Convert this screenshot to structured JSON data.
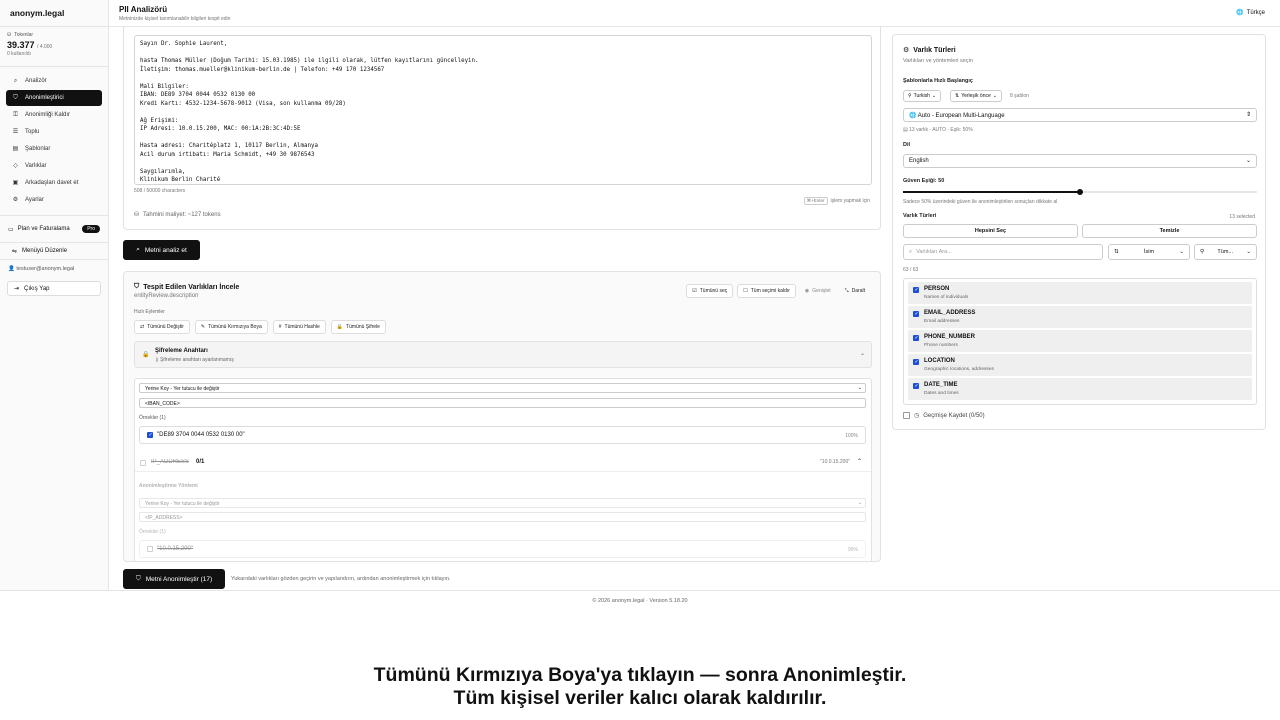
{
  "brand": "anonym.legal",
  "tokens": {
    "label": "Tokenlar",
    "value": "39.377",
    "max": "/ 4.000",
    "used": "0 kullanıldı"
  },
  "nav": [
    {
      "label": "Analizör",
      "icon": "search-icon"
    },
    {
      "label": "Anonimleştirici",
      "icon": "shield-icon",
      "active": true
    },
    {
      "label": "Anonimliği Kaldır",
      "icon": "unlock-icon"
    },
    {
      "label": "Toplu",
      "icon": "layers-icon"
    },
    {
      "label": "Şablonlar",
      "icon": "file-icon"
    },
    {
      "label": "Varlıklar",
      "icon": "tag-icon"
    },
    {
      "label": "Arkadaşları davet et",
      "icon": "gift-icon"
    },
    {
      "label": "Ayarlar",
      "icon": "gear-icon"
    }
  ],
  "plan": {
    "label": "Plan ve Faturalama",
    "badge": "Pro"
  },
  "menu_edit": "Menüyü Düzenle",
  "user": {
    "email": "testuser@anonym.legal",
    "logout": "Çıkış Yap"
  },
  "header": {
    "title": "PII Analizörü",
    "subtitle": "Metninizde kişisel tanımlanabilir bilgileri tespit edin",
    "language": "Türkçe"
  },
  "input": {
    "text": "Sayın Dr. Sophie Laurent,\n\nhasta Thomas Müller (Doğum Tarihi: 15.03.1985) ile ilgili olarak, lütfen kayıtlarını güncelleyin.\nİletişim: thomas.mueller@klinikum-berlin.de | Telefon: +49 170 1234567\n\nMali Bilgiler:\nIBAN: DE89 3704 0044 0532 0130 00\nKredi Kartı: 4532-1234-5678-9012 (Visa, son kullanma 09/28)\n\nAğ Erişimi:\nIP Adresi: 10.0.15.200, MAC: 00:1A:2B:3C:4D:5E\n\nHasta adresi: Charitéplatz 1, 10117 Berlin, Almanya\nAcil durum irtibatı: Maria Schmidt, +49 30 9876543\n\nSaygılarımla,\nKlinikum Berlin Charité",
    "char_count": "508 / 50000 characters",
    "shortcut_key": "⌘+Enter",
    "shortcut_hint": "işlem yapmak için",
    "cost": "Tahmini maliyet: ~127 tokens"
  },
  "analyze_button": "Metni analiz et",
  "review": {
    "title": "Tespit Edilen Varlıkları İncele",
    "description": "entityReview.description",
    "select_all": "Tümünü seç",
    "deselect_all": "Tüm seçimi kaldır",
    "expand": "Genişlet",
    "collapse": "Daralt",
    "quick_label": "Hızlı Eylemler",
    "quick": [
      {
        "label": "Tümünü Değiştir",
        "icon": "replace-icon"
      },
      {
        "label": "Tümünü Kırmızıya Boya",
        "icon": "redact-icon"
      },
      {
        "label": "Tümünü Hashle",
        "icon": "hash-icon"
      },
      {
        "label": "Tümünü Şifrele",
        "icon": "lock-icon"
      }
    ],
    "encryption": {
      "title": "Şifreleme Anahtarı",
      "subtitle": "Şifreleme anahtarı ayarlanmamış"
    },
    "iban": {
      "method": "Yerine Koy - Yer tutucu ile değiştir",
      "placeholder": "<IBAN_CODE>",
      "examples_label": "Örnekler (1)",
      "example": "\"DE89 3704 0044 0532 0130 00\"",
      "score": "100%"
    },
    "ip": {
      "name": "IP_ADDRESS",
      "count": "0/1",
      "preview": "\"10.0.15.200\"",
      "method_label": "Anonimleştirme Yöntemi",
      "method": "Yerine Koy - Yer tutucu ile değiştir",
      "placeholder": "<IP_ADDRESS>",
      "examples_label": "Örnekler (1)",
      "example": "\"10.0.15.200\"",
      "score": "95%"
    }
  },
  "anonymize_button": "Metni Anonimleştir (17)",
  "anonymize_hint": "Yukarıdaki varlıkları gözden geçirin ve yapılandırın, ardından anonimleştirmek için tıklayın.",
  "right": {
    "title": "Varlık Türleri",
    "subtitle": "Varlıkları ve yöntemleri seçin",
    "quick_start": "Şablonlarla Hızlı Başlangıç",
    "chip_lang": "Turkish",
    "chip_sort": "Yerleşik önce",
    "template_count": "8 şablon",
    "preset": "🌐 Auto - European Multi-Language",
    "preset_meta": "13 varlık · AUTO · Eşik: 50%",
    "lang_label": "Dil",
    "lang_value": "English",
    "threshold_label": "Güven Eşiği: 50",
    "threshold": 0.5,
    "threshold_hint": "Sadece 50% üzerindeki güven ile anonimleştirilen sonuçları dikkate al",
    "types_label": "Varlık Türleri",
    "selected": "13 selected",
    "select_all": "Hepsini Seç",
    "clear": "Temizle",
    "search_placeholder": "Varlıkları Ara...",
    "sort_name": "İsim",
    "filter_all": "Tüm...",
    "count": "63 / 63",
    "entities": [
      {
        "name": "PERSON",
        "desc": "Names of individuals"
      },
      {
        "name": "EMAIL_ADDRESS",
        "desc": "Email addresses"
      },
      {
        "name": "PHONE_NUMBER",
        "desc": "Phone numbers"
      },
      {
        "name": "LOCATION",
        "desc": "Geographic locations, addresses"
      },
      {
        "name": "DATE_TIME",
        "desc": "Dates and times"
      }
    ],
    "history": "Geçmişe Kaydet (0/50)"
  },
  "footer": "© 2026 anonym.legal · Version 5.18.20",
  "caption_line1": "Tümünü Kırmızıya Boya'ya tıklayın — sonra Anonimleştir.",
  "caption_line2": "Tüm kişisel veriler kalıcı olarak kaldırılır."
}
